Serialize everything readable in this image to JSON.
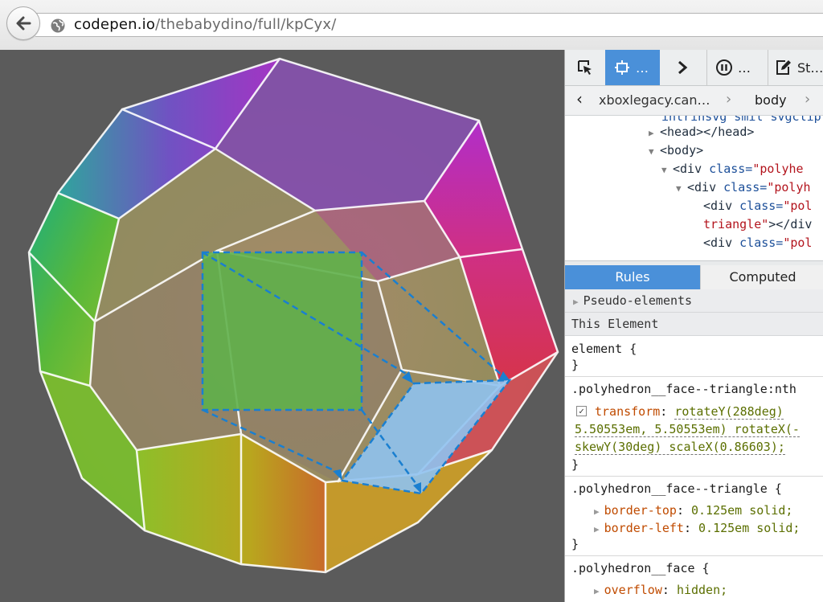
{
  "browser": {
    "url_host": "codepen.io",
    "url_path": "/thebabydino/full/kpCyx/",
    "icons": {
      "back": "back-arrow-icon",
      "site": "globe-icon"
    }
  },
  "devtools": {
    "toolbar": {
      "tool1_icon": "element-picker-icon",
      "tool2_label": "…",
      "tool3_icon": "chevron-right-icon",
      "tool4_label": "…",
      "tool5_label": "St…"
    },
    "breadcrumb": {
      "item1": "xboxlegacy.can…",
      "item2": "body"
    },
    "markup": {
      "line0": "intrinsvg smil svgclip",
      "line1": "<head></head>",
      "line2": "<body>",
      "line3_tag": "<div",
      "line3_attr": " class=",
      "line3_val": "\"polyhe",
      "line4_tag": "<div",
      "line4_attr": " class=",
      "line4_val": "\"polyh",
      "line5_tag": "<div",
      "line5_attr": " class=",
      "line5_val": "\"pol",
      "line6_val": "triangle\"",
      "line6_tag": "></div",
      "line7_tag": "<div",
      "line7_attr": " class=",
      "line7_val": "\"pol"
    },
    "tabs": {
      "rules": "Rules",
      "computed": "Computed"
    },
    "rules": {
      "pseudo": "Pseudo-elements",
      "this_element": "This Element",
      "element_open": "element {",
      "close": "}",
      "sel1": ".polyhedron__face--triangle:nth",
      "sel1_prop": "transform",
      "sel1_val1": "rotateY(288deg)",
      "sel1_val2": "5.50553em, 5.50553em) rotateX(-",
      "sel1_val3": "skewY(30deg) scaleX(0.86603);",
      "sel2": ".polyhedron__face--triangle {",
      "sel2_prop1": "border-top",
      "sel2_val1": "0.125em solid;",
      "sel2_prop2": "border-left",
      "sel2_val2": "0.125em solid;",
      "sel3": ".polyhedron__face {",
      "sel3_prop1": "overflow",
      "sel3_val1": "hidden;"
    }
  },
  "colors": {
    "accent": "#4a90d9",
    "page_bg": "#5b5b5b",
    "highlight_stroke": "#1a7fd0"
  }
}
